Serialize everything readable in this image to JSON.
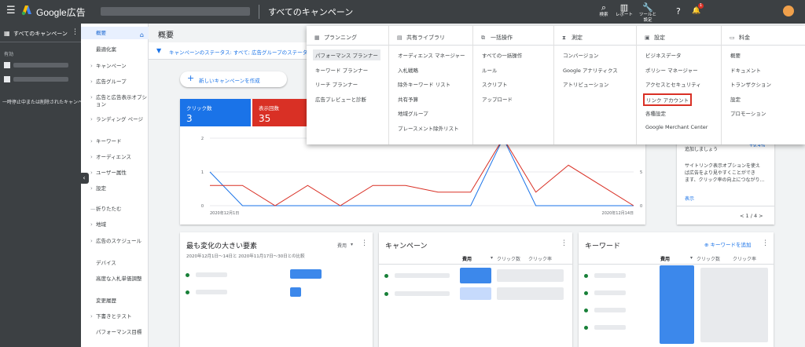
{
  "topbar": {
    "brand": "Google広告",
    "campaign_scope": "すべてのキャンペーン",
    "buttons": [
      {
        "icon": "search-icon",
        "glyph": "⌕",
        "label": "検索"
      },
      {
        "icon": "report-icon",
        "glyph": "▥",
        "label": "レポート"
      },
      {
        "icon": "tools-icon",
        "glyph": "🔧",
        "label": "ツールと設定"
      }
    ],
    "help_glyph": "?",
    "bell_glyph": "🔔",
    "bell_badge": "1"
  },
  "leftpanel": {
    "header": "すべてのキャンペーン",
    "section": "有効",
    "note": "一時停止中または削除されたキャンペ"
  },
  "nav": {
    "items": [
      "概要",
      "最適化案",
      "キャンペーン",
      "広告グループ",
      "広告と広告表示オプション",
      "ランディング ページ",
      "キーワード",
      "オーディエンス",
      "ユーザー属性",
      "設定",
      "折りたたむ",
      "地域",
      "広告のスケジュール",
      "デバイス",
      "高度な入札単価調整",
      "変更履歴",
      "下書きとテスト",
      "パフォーマンス目標"
    ]
  },
  "main": {
    "title": "概要",
    "filter": "キャンペーンのステータス: すべて; 広告グループのステータ",
    "new_campaign": "新しいキャンペーンを作成"
  },
  "chart_data": {
    "type": "line",
    "x": [
      "2020年12月1日",
      "2020年12月2日",
      "2020年12月3日",
      "2020年12月4日",
      "2020年12月5日",
      "2020年12月6日",
      "2020年12月7日",
      "2020年12月8日",
      "2020年12月9日",
      "2020年12月10日",
      "2020年12月11日",
      "2020年12月12日",
      "2020年12月13日",
      "2020年12月14日"
    ],
    "x_tick_labels": [
      "2020年12月1日",
      "2020年12月14日"
    ],
    "left_axis_ticks": [
      "2",
      "1",
      "0"
    ],
    "right_axis_ticks": [
      "5",
      "0"
    ],
    "series": [
      {
        "name": "クリック数",
        "color": "#1a73e8",
        "axis": "left",
        "values": [
          1,
          0,
          0,
          0,
          0,
          0,
          0,
          0,
          0,
          2,
          0,
          0,
          0,
          0
        ]
      },
      {
        "name": "表示回数",
        "color": "#d93025",
        "axis": "right",
        "values": [
          3,
          3,
          0,
          3,
          0,
          3,
          3,
          2,
          2,
          10,
          2,
          6,
          3,
          0
        ]
      }
    ],
    "metrics": [
      {
        "label": "クリック数",
        "value": "3",
        "color": "#1a73e8"
      },
      {
        "label": "表示回数",
        "value": "35",
        "color": "#d93025"
      }
    ]
  },
  "rightcard": {
    "pct": "+9.4%",
    "line1": "追加しましょう",
    "lines": [
      "サイトリンク表示オプションを使え",
      "ば広告をより見やすくことができ",
      "ます、クリック率の向上につながり..."
    ],
    "show": "表示",
    "pager": "< 1 / 4 >"
  },
  "cards": {
    "movers": {
      "title": "最も変化の大きい要素",
      "sub": "2020年12月1日～14日と 2020年11月17日～30日との比較",
      "sort": "費用"
    },
    "campaigns": {
      "title": "キャンペーン",
      "cols": [
        "費用",
        "クリック数",
        "クリック率"
      ]
    },
    "keywords": {
      "title": "キーワード",
      "add": "キーワードを追加",
      "cols": [
        "費用",
        "クリック数",
        "クリック率"
      ]
    }
  },
  "dropdown": {
    "columns": [
      {
        "title": "プランニング",
        "icon": "calendar-icon",
        "glyph": "▦",
        "items": [
          "パフォーマンス プランナー",
          "キーワード プランナー",
          "リーチ プランナー",
          "広告プレビューと診断"
        ],
        "selected": 0
      },
      {
        "title": "共有ライブラリ",
        "icon": "library-icon",
        "glyph": "▤",
        "items": [
          "オーディエンス マネージャー",
          "入札戦略",
          "除外キーワード リスト",
          "共有予算",
          "地域グループ",
          "プレースメント除外リスト"
        ]
      },
      {
        "title": "一括操作",
        "icon": "bulk-icon",
        "glyph": "⧉",
        "items": [
          "すべての一括操作",
          "ルール",
          "スクリプト",
          "アップロード"
        ]
      },
      {
        "title": "測定",
        "icon": "measure-icon",
        "glyph": "⧗",
        "items": [
          "コンバージョン",
          "Google アナリティクス",
          "アトリビューション"
        ]
      },
      {
        "title": "設定",
        "icon": "settings-icon",
        "glyph": "▣",
        "items": [
          "ビジネスデータ",
          "ポリシー マネージャー",
          "アクセスとセキュリティ",
          "リンク アカウント",
          "各種設定",
          "Google Merchant Center"
        ],
        "highlighted": 3
      },
      {
        "title": "料金",
        "icon": "billing-icon",
        "glyph": "▭",
        "items": [
          "概要",
          "ドキュメント",
          "トランザクション",
          "設定",
          "プロモーション"
        ]
      }
    ]
  },
  "colors": {
    "topbar": "#3c4043",
    "accent": "#1a73e8",
    "red": "#d93025",
    "green": "#188038"
  }
}
